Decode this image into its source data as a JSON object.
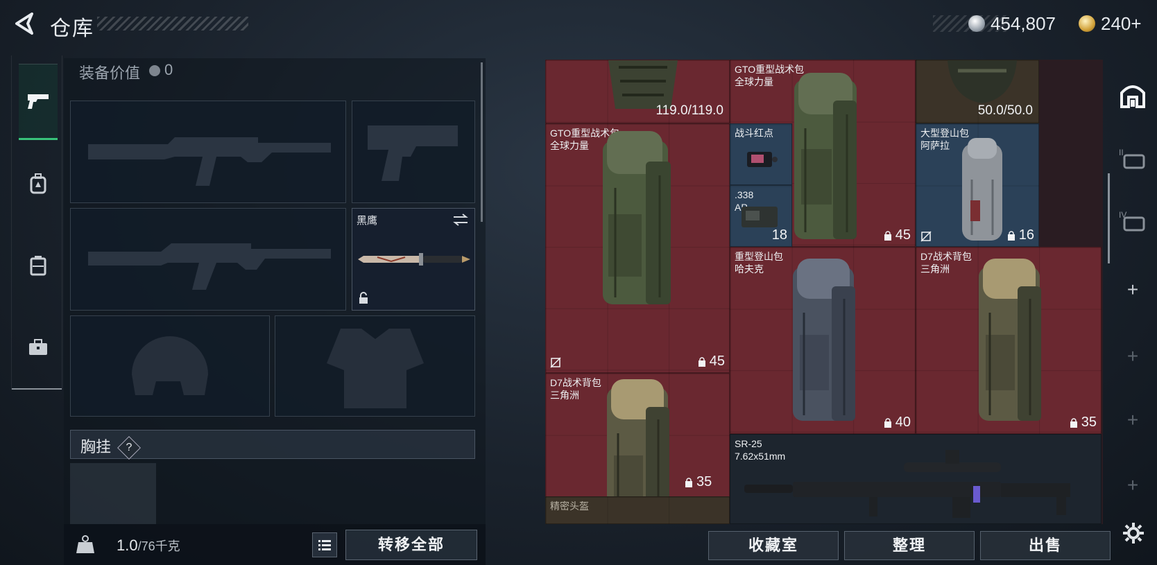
{
  "header": {
    "title": "仓库",
    "currency": [
      {
        "icon": "silver-coin-icon",
        "value": "454,807"
      },
      {
        "icon": "gold-coin-icon",
        "value": "240+"
      }
    ]
  },
  "equipment": {
    "value_label": "装备价值",
    "value": "0",
    "knife_name": "黑鹰",
    "chest_rig_label": "胸挂",
    "help_mark": "?"
  },
  "footer": {
    "weight_current": "1.0",
    "weight_max": "/76千克",
    "transfer_all": "转移全部",
    "collection_room": "收藏室",
    "sort": "整理",
    "sell": "出售"
  },
  "items": {
    "top_left_durability": "119.0/119.0",
    "top_mid_name": "GTO重型战术包\n全球力量",
    "top_right_durability": "50.0/50.0",
    "bag1_name": "GTO重型战术包\n全球力量",
    "bag1_count": "45",
    "redot_name": "战斗红点",
    "ammo_name": ".338\nAP",
    "ammo_count": "18",
    "bag2_count": "45",
    "bag3_name": "大型登山包\n阿萨拉",
    "bag3_count": "16",
    "bag4_name": "重型登山包\n哈夫克",
    "bag4_count": "40",
    "bag5_name": "D7战术背包\n三角洲",
    "bag5_count": "35",
    "bag6_name": "D7战术背包\n三角洲",
    "bag6_count": "35",
    "rifle_name": "SR-25\n7.62x51mm",
    "helmet_name": "精密头盔"
  },
  "colors": {
    "accent_green": "#38c37a",
    "cell_red": "#6a2830",
    "cell_blue": "#2b4158"
  }
}
